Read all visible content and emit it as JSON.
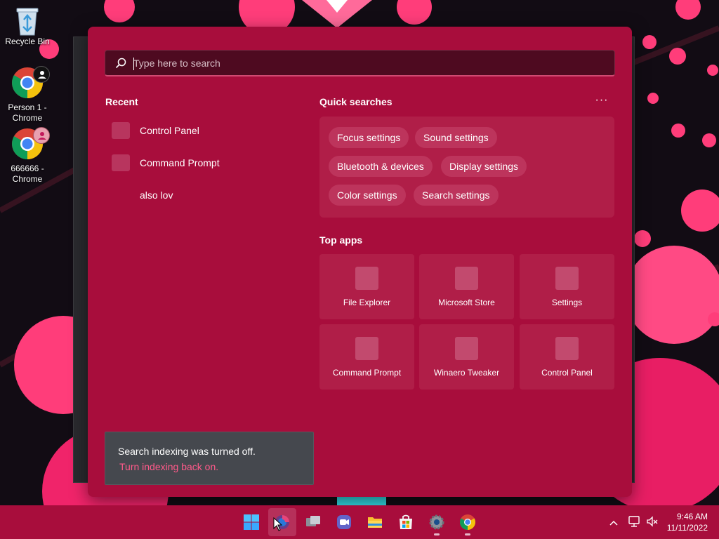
{
  "desktop": {
    "icons": [
      {
        "label": "Recycle Bin"
      },
      {
        "label": "Person 1 - Chrome"
      },
      {
        "label": "666666 - Chrome"
      }
    ]
  },
  "search": {
    "placeholder": "Type here to search"
  },
  "recent": {
    "title": "Recent",
    "items": [
      {
        "label": "Control Panel"
      },
      {
        "label": "Command Prompt"
      },
      {
        "label": "also lov"
      }
    ]
  },
  "quick_searches": {
    "title": "Quick searches",
    "more": "···",
    "chips": [
      {
        "label": "Focus settings"
      },
      {
        "label": "Sound settings"
      },
      {
        "label": "Bluetooth & devices"
      },
      {
        "label": "Display settings"
      },
      {
        "label": "Color settings"
      },
      {
        "label": "Search settings"
      }
    ]
  },
  "top_apps": {
    "title": "Top apps",
    "apps": [
      {
        "label": "File Explorer"
      },
      {
        "label": "Microsoft Store"
      },
      {
        "label": "Settings"
      },
      {
        "label": "Command Prompt"
      },
      {
        "label": "Winaero Tweaker"
      },
      {
        "label": "Control Panel"
      }
    ]
  },
  "toast": {
    "message": "Search indexing was turned off.",
    "link": "Turn indexing back on."
  },
  "taskbar": {
    "time": "9:46 AM",
    "date": "11/11/2022",
    "accent": "#a80d3c"
  }
}
